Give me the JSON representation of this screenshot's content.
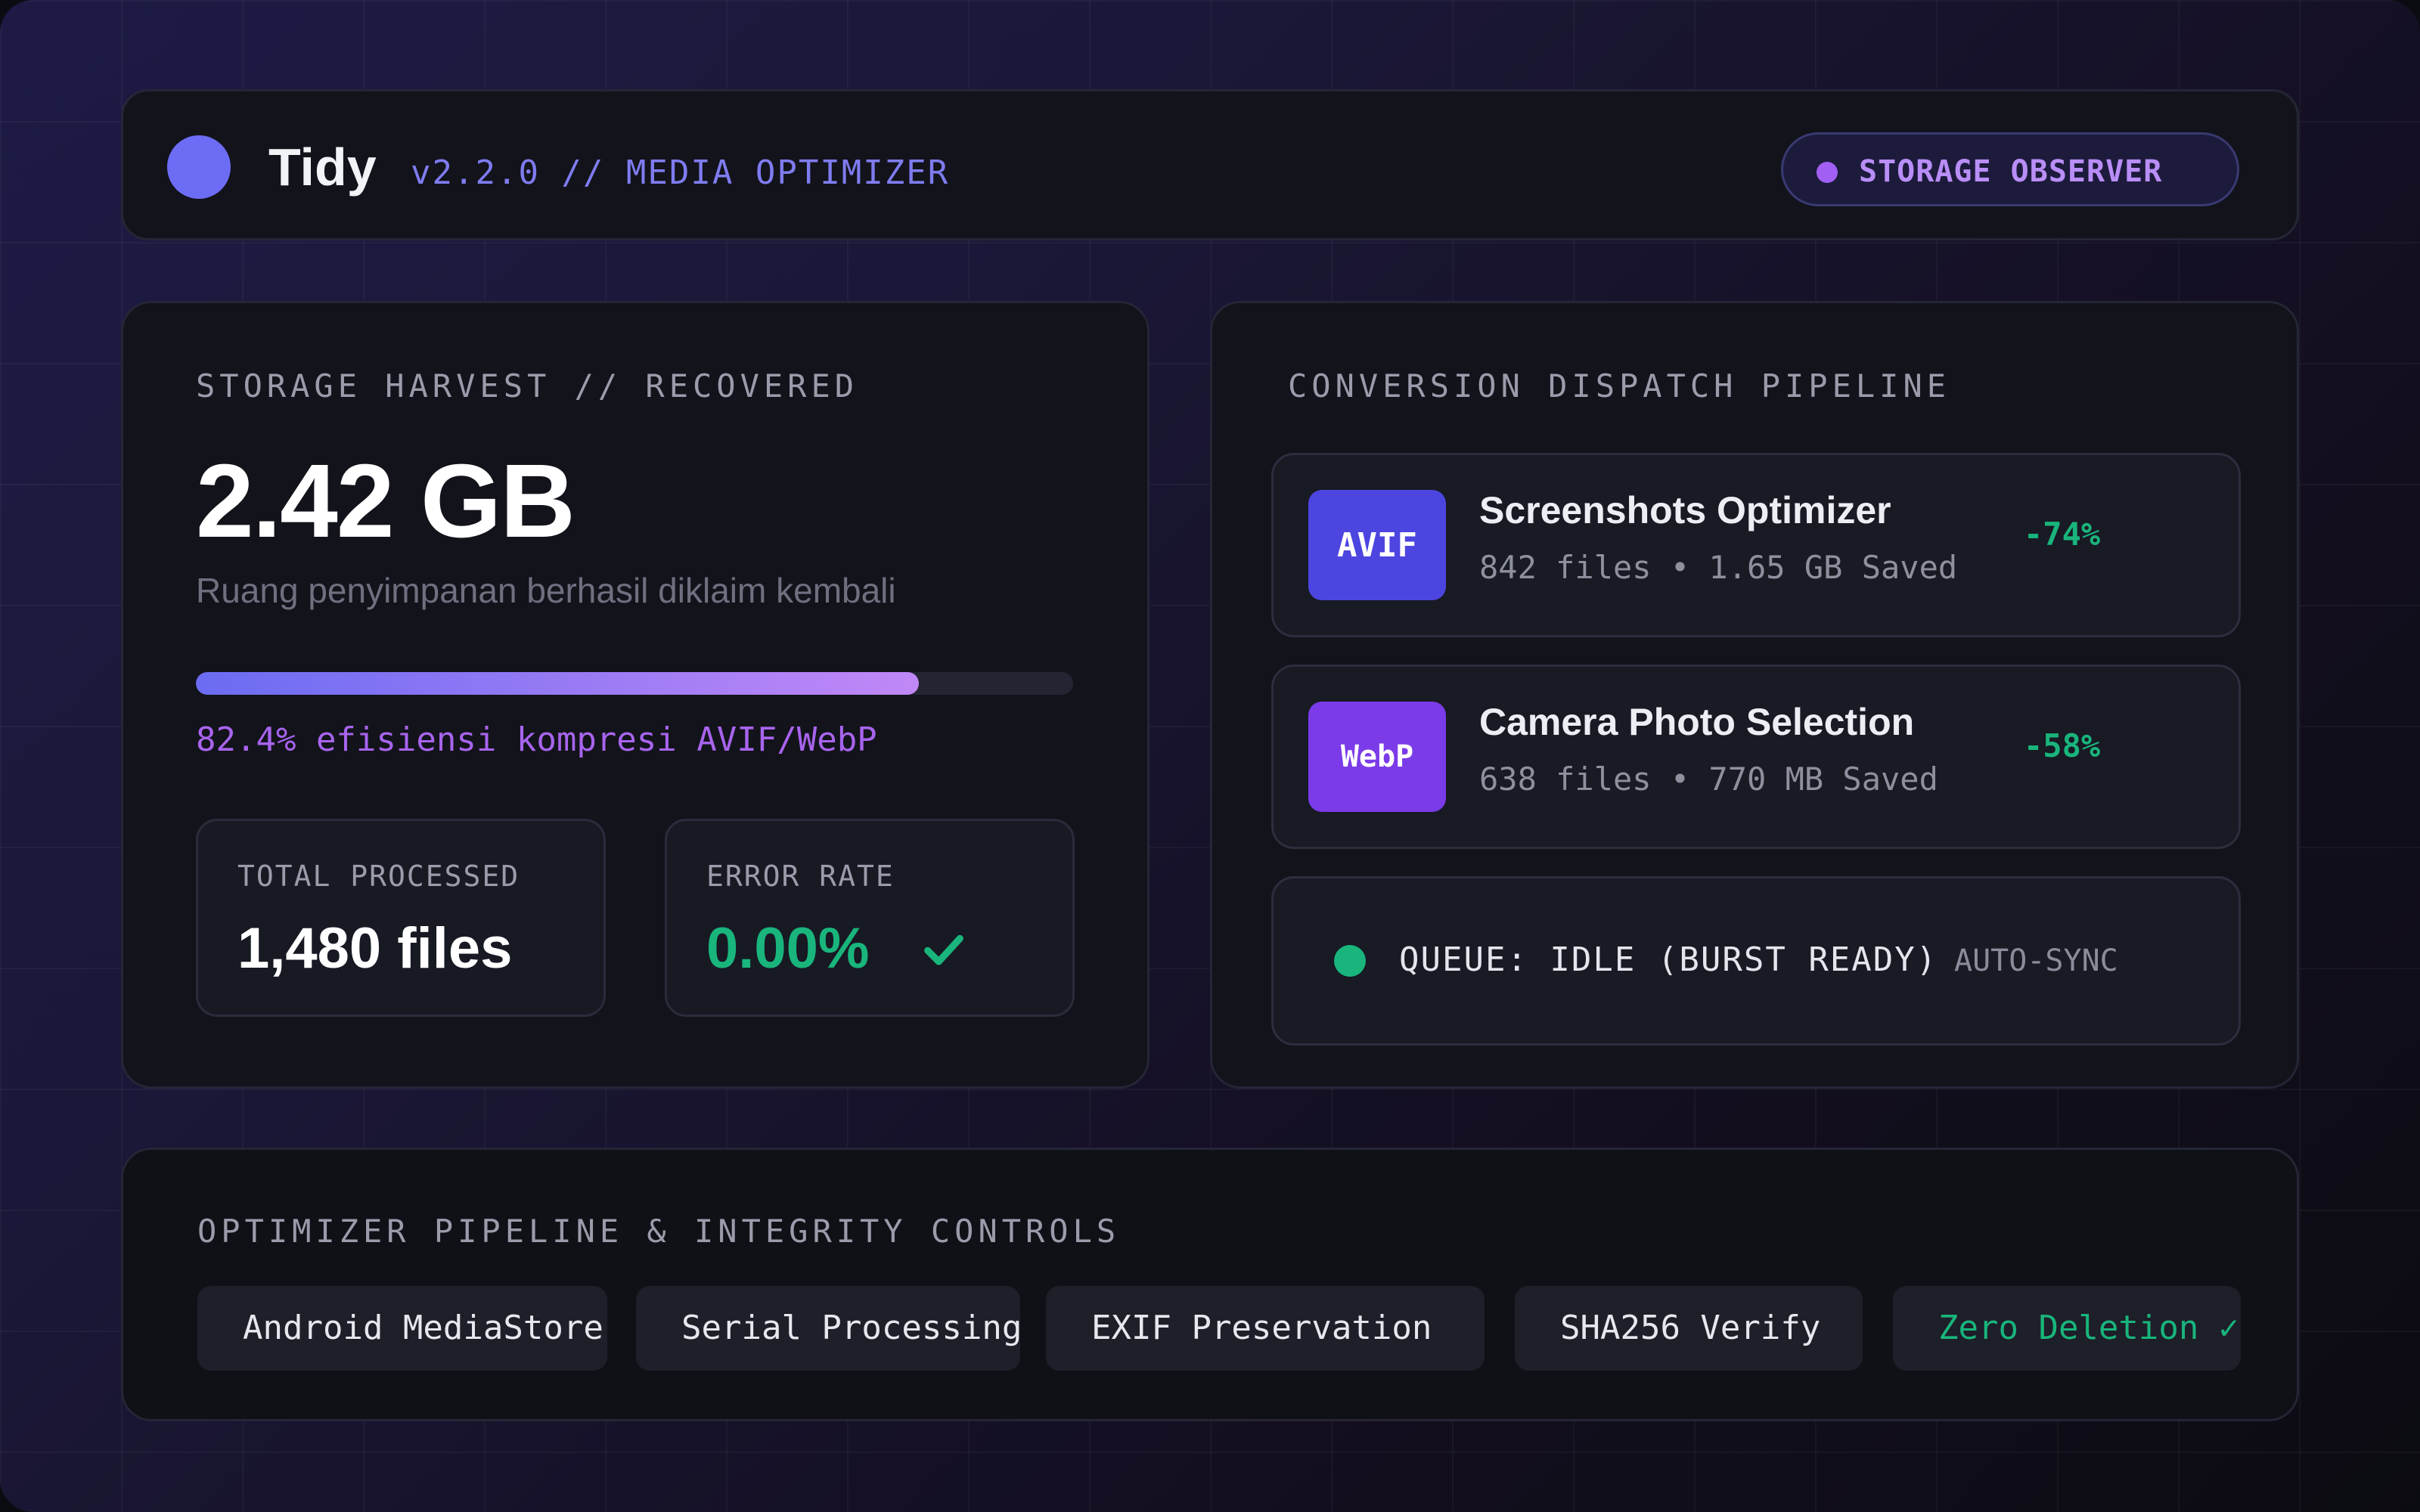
{
  "header": {
    "app_name": "Tidy",
    "app_subtitle": "v2.2.0 // MEDIA OPTIMIZER",
    "observer_label": "STORAGE OBSERVER"
  },
  "storage": {
    "title": "STORAGE HARVEST // RECOVERED",
    "value": "2.42 GB",
    "description": "Ruang penyimpanan berhasil diklaim kembali",
    "progress_percent": 82.4,
    "progress_text": "82.4% efisiensi kompresi AVIF/WebP",
    "stats": {
      "total_label": "TOTAL PROCESSED",
      "total_value": "1,480 files",
      "error_label": "ERROR RATE",
      "error_value": "0.00%"
    }
  },
  "pipeline": {
    "title": "CONVERSION DISPATCH PIPELINE",
    "items": [
      {
        "badge": "AVIF",
        "name": "Screenshots Optimizer",
        "meta": "842 files • 1.65 GB Saved",
        "reduction": "-74%"
      },
      {
        "badge": "WebP",
        "name": "Camera Photo Selection",
        "meta": "638 files • 770 MB Saved",
        "reduction": "-58%"
      }
    ],
    "queue": {
      "status": "QUEUE: IDLE (BURST READY)",
      "sync": "AUTO-SYNC"
    }
  },
  "controls": {
    "title": "OPTIMIZER PIPELINE & INTEGRITY CONTROLS",
    "chips": [
      "Android MediaStore",
      "Serial Processing",
      "EXIF Preservation",
      "SHA256 Verify",
      "Zero Deletion ✓"
    ]
  },
  "colors": {
    "accent_indigo": "#6c6cf5",
    "accent_purple": "#a864ee",
    "success_green": "#19b57c",
    "panel_bg": "#12131b"
  },
  "icons": {
    "logo": "logo-dot-icon",
    "observer": "status-dot-icon",
    "error_ok": "check-icon",
    "queue": "status-dot-icon"
  }
}
